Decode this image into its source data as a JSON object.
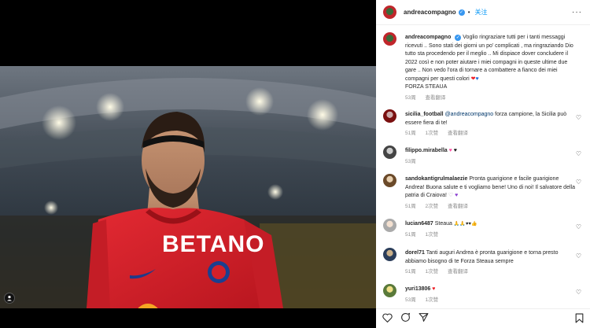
{
  "post": {
    "author": "andreacompagno",
    "follow_label": "关注",
    "dot": "•",
    "more": "···"
  },
  "caption": {
    "username": "andreacompagno",
    "text": "Voglio ringraziare tutti per i tanti messaggi ricevuti .. Sono stati dei giorni un po' complicati , ma ringraziando Dio tutto sta procedendo per il meglio .. Mi dispiace dover concludere il 2022 così e non poter aiutare i miei compagni in queste ultime due gare .. Non vedo l'ora di tornare a combattere a fianco dei miei compagni per questi colori",
    "emoji1": "❤",
    "emoji2": "♥",
    "tail": "FORZA STEAUA",
    "time": "53周",
    "translate": "查看翻译"
  },
  "comments": [
    {
      "username": "sicilia_football",
      "mention": "@andreacompagno",
      "text": "forza campione, la Sicilia può essere fiera di te!",
      "time": "51周",
      "likes": "1次赞",
      "translate": "查看翻译"
    },
    {
      "username": "filippo.mirabella",
      "text": "",
      "emoji1": "♥",
      "emoji2": "♥",
      "time": "53周"
    },
    {
      "username": "sandokantigrulmalaezie",
      "text": "Pronta guarigione e facile guarigione Andrea! Buona salute e ti vogliamo bene! Uno di noi! Il salvatore della patria di Craiova!",
      "emoji1": "♡",
      "emoji2": "♥",
      "time": "51周",
      "likes": "2次赞",
      "translate": "查看翻译"
    },
    {
      "username": "lucian6487",
      "text": "Steaua",
      "emojis": "🙏🙏♥♥👍",
      "time": "51周",
      "likes": "1次赞"
    },
    {
      "username": "dorel71",
      "text": "Tanti auguri Andrea è pronta guarigione e torna presto abbiamo bisogno di te Forza Steaua sempre",
      "time": "51周",
      "likes": "1次赞",
      "translate": "查看翻译"
    },
    {
      "username": "yuri13806",
      "text": "",
      "emoji1": "♥",
      "time": "53周",
      "likes": "1次赞"
    }
  ],
  "jersey": {
    "sponsor": "BETANO"
  },
  "icons": {
    "like": "heart-icon",
    "comment": "comment-icon",
    "share": "share-icon",
    "save": "bookmark-icon",
    "tag": "user-tag-icon"
  },
  "colors": {
    "accent": "#0095f6",
    "verified": "#3897f0",
    "jersey": "#d4202a",
    "muted": "#8e8e8e"
  }
}
